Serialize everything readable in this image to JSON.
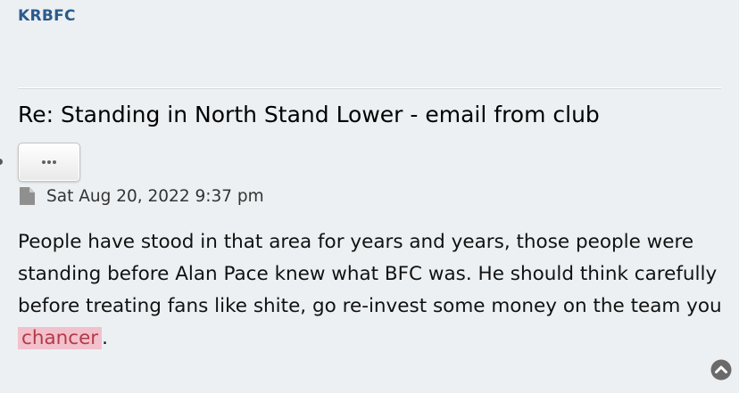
{
  "post": {
    "author": "KRBFC",
    "title": "Re: Standing in North Stand Lower - email from club",
    "timestamp": "Sat Aug 20, 2022 9:37 pm",
    "body_before": "People have stood in that area for years and years, those people were standing before Alan Pace knew what BFC was. He should think carefully before treating fans like shite, go re-invest some money on the team you ",
    "body_highlight": "chancer",
    "body_after": "."
  },
  "icons": {
    "more_actions": "ellipsis-icon",
    "post_link": "file-icon",
    "back_to_top": "chevron-up-circle-icon"
  },
  "colors": {
    "background": "#ecf0f3",
    "author": "#2b5b8c",
    "highlight_bg": "#f2c1cb",
    "highlight_text": "#b23a4a"
  }
}
